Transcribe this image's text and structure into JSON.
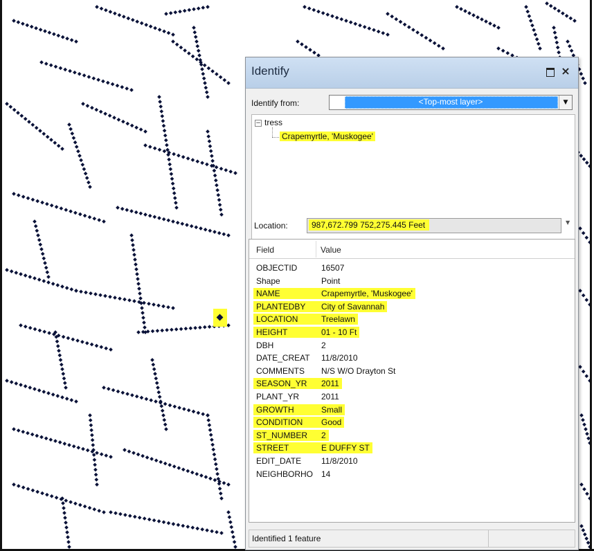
{
  "window": {
    "title": "Identify",
    "maximize_icon": "maximize-icon",
    "close_label": "×"
  },
  "identify_from": {
    "label": "Identify from:",
    "selected": "<Top-most layer>"
  },
  "tree": {
    "layer": "tress",
    "feature": "Crapemyrtle, 'Muskogee'"
  },
  "location": {
    "label": "Location:",
    "value": "987,672.799  752,275.445 Feet"
  },
  "table": {
    "columns": [
      "Field",
      "Value"
    ],
    "rows": [
      {
        "field": "OBJECTID",
        "value": "16507",
        "highlighted": false
      },
      {
        "field": "Shape",
        "value": "Point",
        "highlighted": false
      },
      {
        "field": "NAME",
        "value": "Crapemyrtle, 'Muskogee'",
        "highlighted": true
      },
      {
        "field": "PLANTEDBY",
        "value": "City of Savannah",
        "highlighted": true
      },
      {
        "field": "LOCATION",
        "value": "Treelawn",
        "highlighted": true
      },
      {
        "field": "HEIGHT",
        "value": "01 - 10 Ft",
        "highlighted": true
      },
      {
        "field": "DBH",
        "value": "2",
        "highlighted": false
      },
      {
        "field": "DATE_CREAT",
        "value": "11/8/2010",
        "highlighted": false
      },
      {
        "field": "COMMENTS",
        "value": "N/S W/O Drayton St",
        "highlighted": false
      },
      {
        "field": "SEASON_YR",
        "value": "2011",
        "highlighted": true
      },
      {
        "field": "PLANT_YR",
        "value": "2011",
        "highlighted": false
      },
      {
        "field": "GROWTH",
        "value": "Small",
        "highlighted": true
      },
      {
        "field": "CONDITION",
        "value": "Good",
        "highlighted": true
      },
      {
        "field": "ST_NUMBER",
        "value": "2",
        "highlighted": true
      },
      {
        "field": "STREET",
        "value": "E DUFFY ST",
        "highlighted": true
      },
      {
        "field": "EDIT_DATE",
        "value": "11/8/2010",
        "highlighted": false
      },
      {
        "field": "NEIGHBORHO",
        "value": "14",
        "highlighted": false
      }
    ]
  },
  "status": "Identified 1 feature",
  "colors": {
    "highlight": "#ffff33",
    "point": "#0a1238",
    "selection": "#3399ff"
  }
}
